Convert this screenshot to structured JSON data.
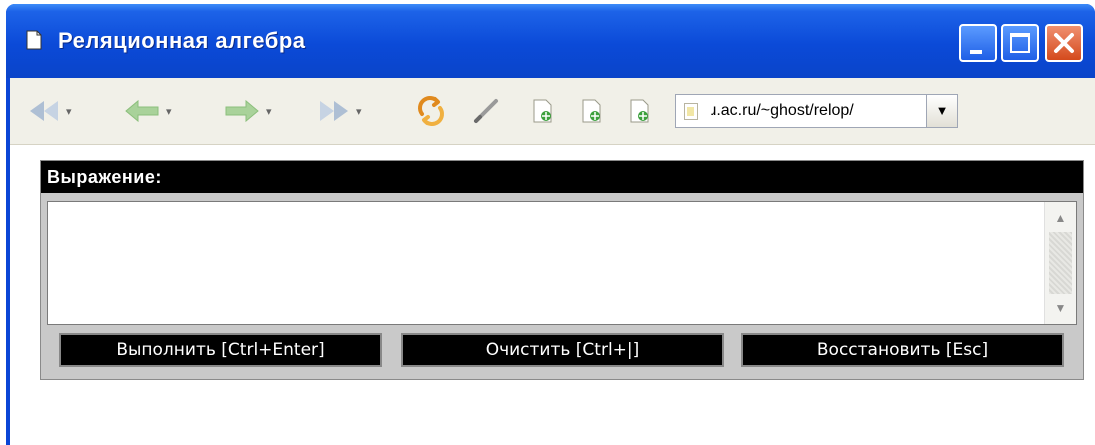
{
  "window": {
    "title": "Реляционная алгебра",
    "title_color": "#ffffff",
    "titlebar_color": "#0a4ad8"
  },
  "titlebar_buttons": {
    "minimize_icon": "minimize-icon",
    "maximize_icon": "maximize-icon",
    "close_icon": "close-icon"
  },
  "toolbar": {
    "items": [
      {
        "name": "first-icon",
        "glyph": "◀◀"
      },
      {
        "name": "back-icon",
        "glyph": "⬅"
      },
      {
        "name": "forward-icon",
        "glyph": "➡"
      },
      {
        "name": "last-icon",
        "glyph": "▶▶"
      },
      {
        "name": "refresh-icon",
        "glyph": "⟳"
      },
      {
        "name": "edit-icon",
        "glyph": "/"
      },
      {
        "name": "page-add-icon-1",
        "glyph": "▣"
      },
      {
        "name": "page-add-icon-2",
        "glyph": "▣"
      },
      {
        "name": "page-add-icon-3",
        "glyph": "▣"
      }
    ],
    "address": "ɹ.ac.ru/~ghost/relop/",
    "address_dropdown_glyph": "▼"
  },
  "expression": {
    "header": "Выражение:",
    "value": "",
    "scroll_up_glyph": "▲",
    "scroll_down_glyph": "▼"
  },
  "buttons": {
    "run": "Выполнить [Ctrl+Enter]",
    "clear": "Очистить [Ctrl+|]",
    "restore": "Восстановить [Esc]"
  },
  "colors": {
    "accent": "#0a4ad8",
    "header_bg": "#000000",
    "panel_bg": "#c9c9c9"
  }
}
